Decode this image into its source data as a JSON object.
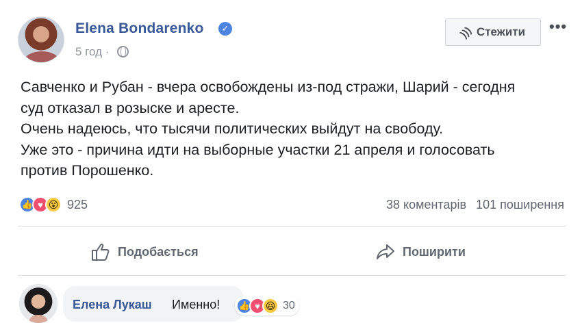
{
  "post": {
    "author": "Elena Bondarenko",
    "time": "5 год",
    "separator": "·",
    "follow_label": "Стежити",
    "more_label": "•••",
    "text_lines": [
      "Савченко и Рубан - вчера освобождены из-под стражи, Шарий - сегодня",
      "суд отказал в розыске и аресте.",
      "Очень надеюсь, что тысячи политических выйдут на свободу.",
      "Уже это - причина идти на выборные участки 21 апреля и голосовать",
      "против Порошенко."
    ],
    "reactions": {
      "icons": [
        "like-reaction",
        "love-reaction",
        "wow-reaction"
      ],
      "count": "925"
    },
    "comments_count": "38 коментарів",
    "shares_count": "101 поширення"
  },
  "actions": {
    "like_label": "Подобається",
    "share_label": "Поширити"
  },
  "comment": {
    "author": "Елена Лукаш",
    "text": "Именно!",
    "reactions": {
      "icons": [
        "like-reaction",
        "love-reaction",
        "haha-reaction"
      ],
      "count": "30"
    }
  },
  "colors": {
    "link_blue": "#385898",
    "like_blue": "#4c84e4",
    "love_red": "#f0506e",
    "wow_yellow": "#f7c842",
    "meta_gray": "#90949c",
    "action_gray": "#606770"
  }
}
